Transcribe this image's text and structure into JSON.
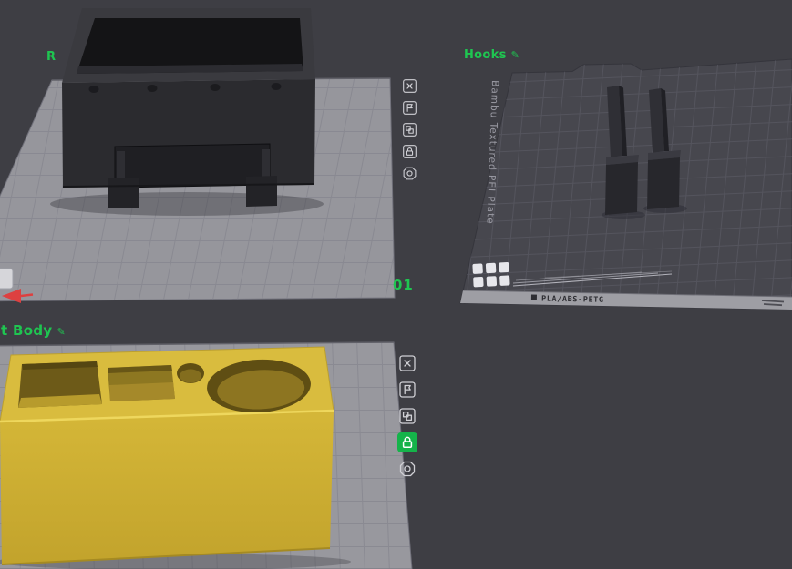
{
  "colors": {
    "background": "#3e3e44",
    "accent_green": "#1fc551",
    "plate_light": "#96969c",
    "plate_dark": "#47474e",
    "model_dark": "#2b2b2f",
    "model_yellow": "#d9bc3e",
    "lock_active": "#15b34a"
  },
  "plates": {
    "plate1": {
      "label": "R",
      "number": "01"
    },
    "plate2": {
      "label": "Hooks",
      "surface_text": "Bambu Textured PEI Plate",
      "strip_label": "PLA/ABS-PETG"
    },
    "plate3": {
      "label": "t Body"
    }
  },
  "icons": {
    "edit": "✎"
  }
}
